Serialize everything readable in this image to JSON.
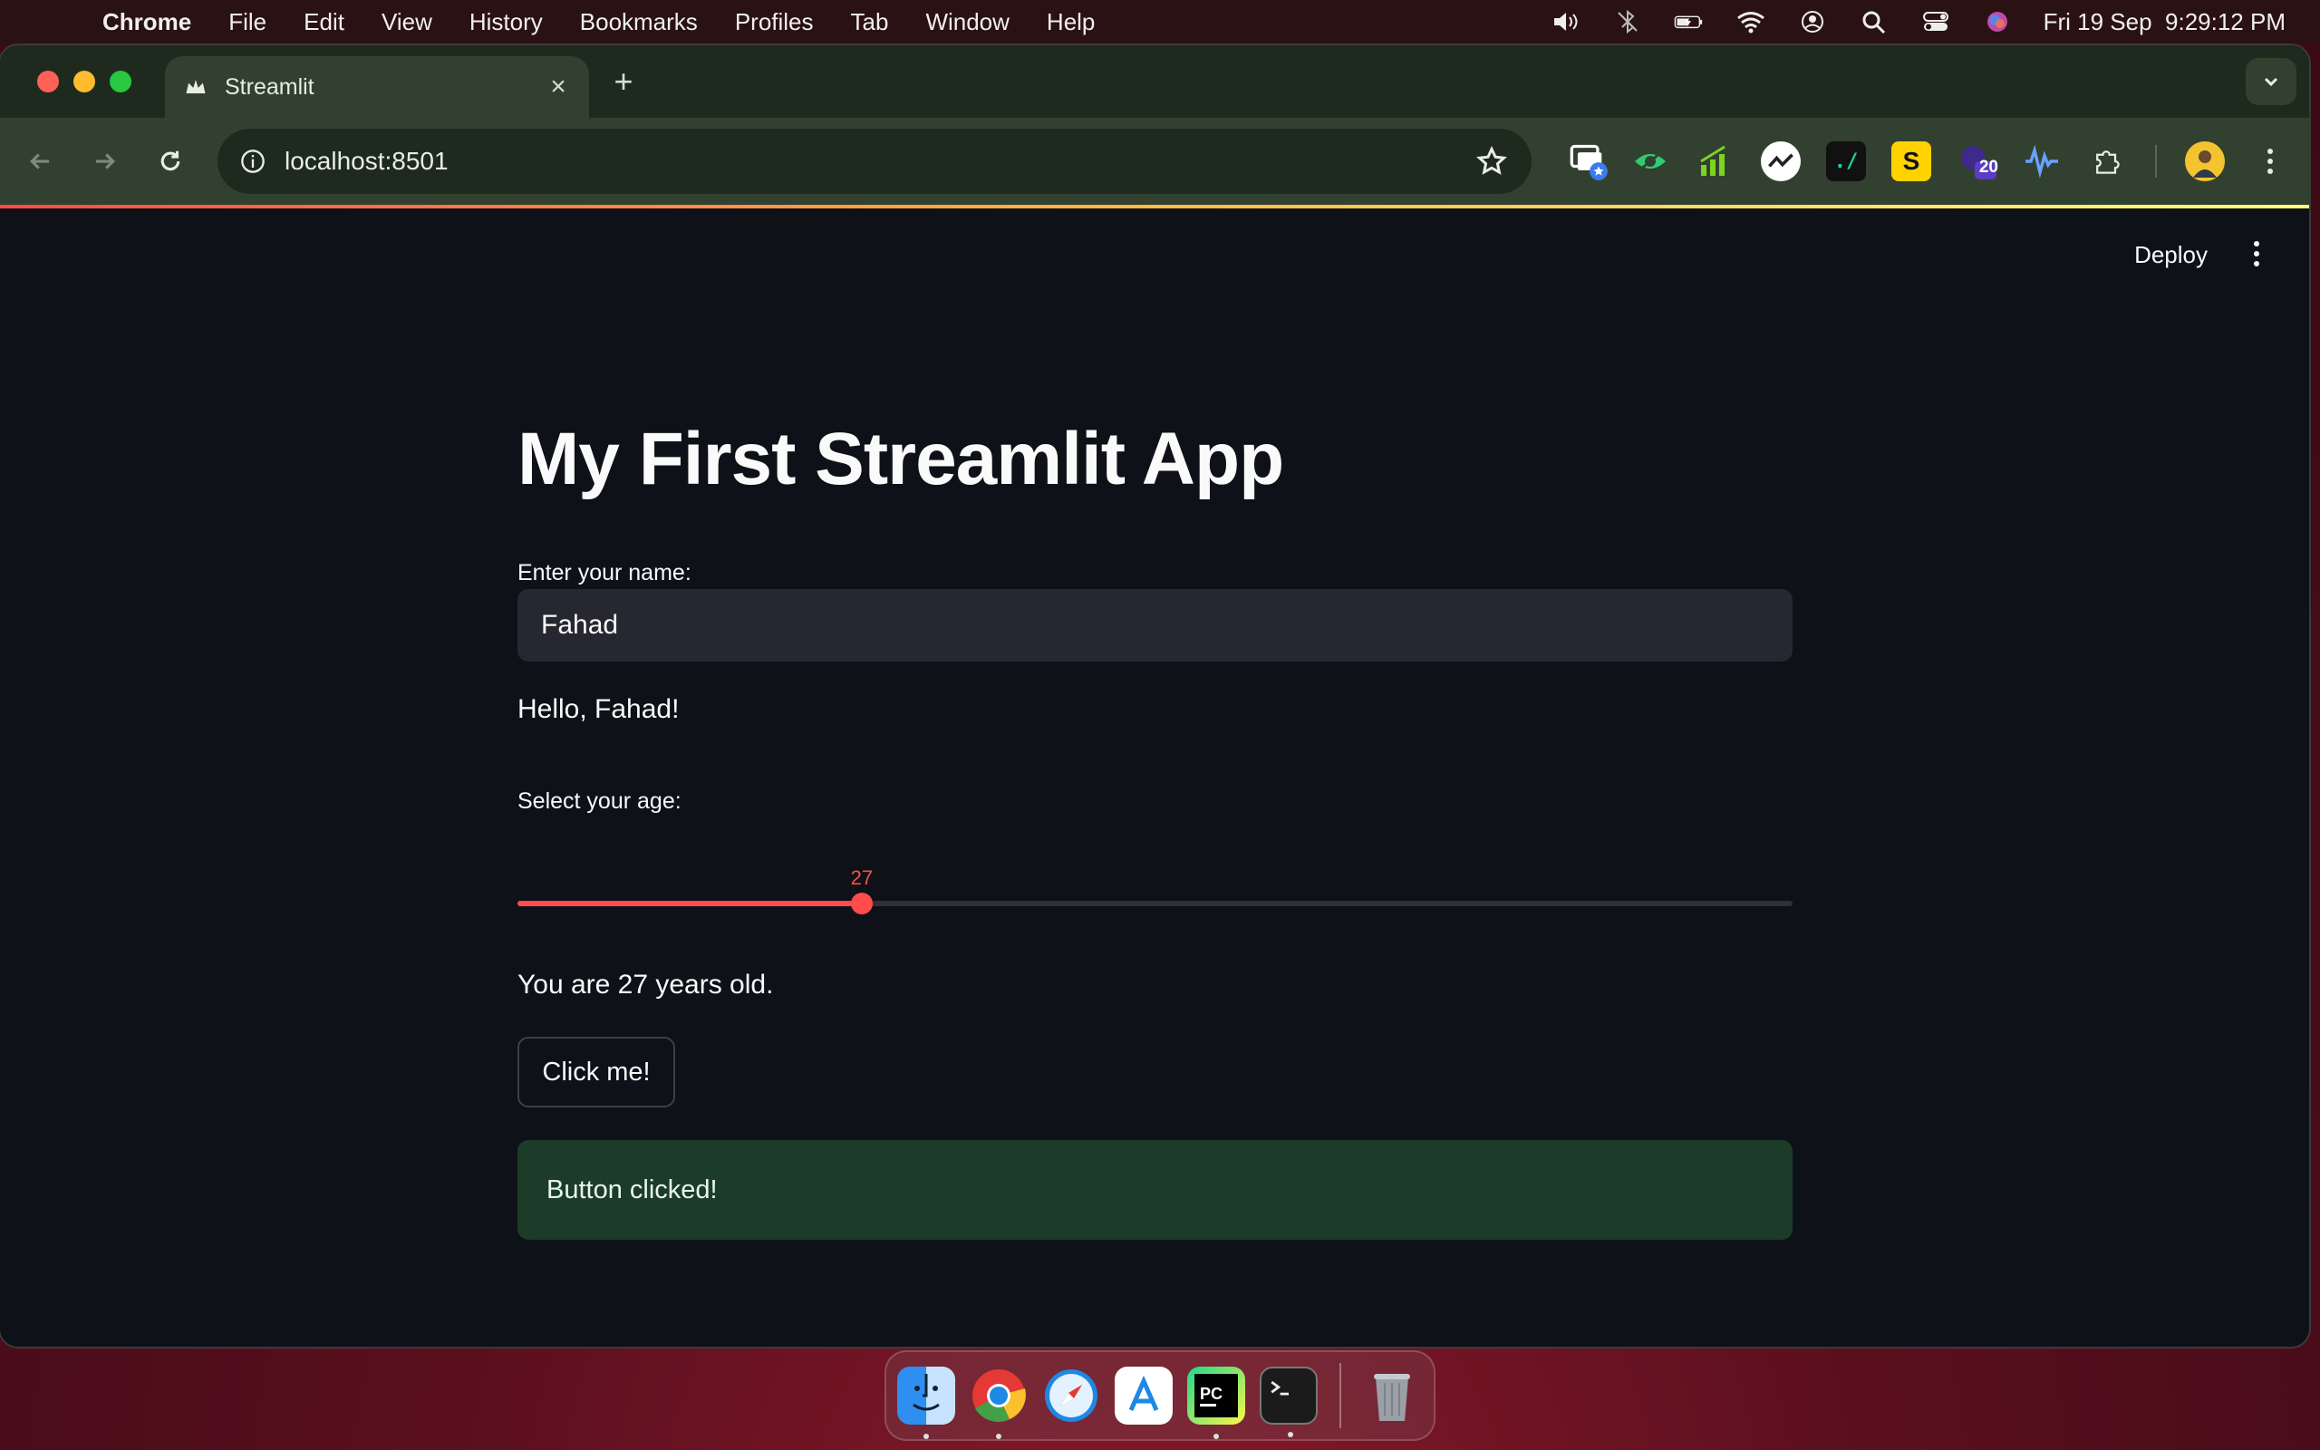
{
  "menubar": {
    "app_name": "Chrome",
    "items": [
      "File",
      "Edit",
      "View",
      "History",
      "Bookmarks",
      "Profiles",
      "Tab",
      "Window",
      "Help"
    ],
    "datetime": "Fri 19 Sep  9:29:12 PM"
  },
  "browser": {
    "tab_title": "Streamlit",
    "url": "localhost:8501",
    "extension_badge": "20"
  },
  "app": {
    "deploy_label": "Deploy",
    "title": "My First Streamlit App",
    "name_label": "Enter your name:",
    "name_value": "Fahad",
    "greeting": "Hello, Fahad!",
    "age_label": "Select your age:",
    "age_value": "27",
    "age_fraction": 0.27,
    "age_text": "You are 27 years old.",
    "button_label": "Click me!",
    "success_message": "Button clicked!"
  },
  "colors": {
    "accent": "#ff4b4b",
    "background": "#0e1117",
    "success_bg": "#1c3b29"
  },
  "dock": {
    "apps": [
      "finder-icon",
      "chrome-icon",
      "safari-icon",
      "app-store-icon",
      "pycharm-icon",
      "terminal-icon",
      "trash-icon"
    ],
    "pycharm_label": "PC"
  }
}
